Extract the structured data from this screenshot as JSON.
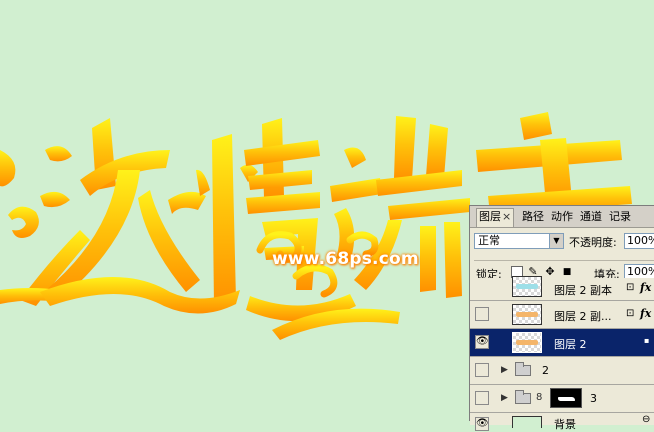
{
  "canvas": {
    "background": "#d1efd0",
    "title_text": "浓情端午",
    "gradient_top": "#fff21a",
    "gradient_bottom": "#ff9200",
    "watermark": "www.68ps.com"
  },
  "panel": {
    "tabs": [
      {
        "label": "图层",
        "active": true,
        "close": "×"
      },
      {
        "label": "路径"
      },
      {
        "label": "动作"
      },
      {
        "label": "通道"
      },
      {
        "label": "记录"
      }
    ],
    "blend_mode": "正常",
    "blend_arrow": "▼",
    "opacity_label": "不透明度:",
    "opacity_value": "100%",
    "lock_label": "锁定:",
    "fill_label": "填充:",
    "fill_value": "100%",
    "lock_icons": [
      "transparent-lock-icon",
      "brush-lock-icon",
      "move-lock-icon",
      "padlock-icon"
    ],
    "layers": [
      {
        "name": "图层 2 副本",
        "visible": false,
        "fx": "fx",
        "thumb_color": "#9edfe8"
      },
      {
        "name": "图层 2 副...",
        "visible": false,
        "fx": "fx",
        "thumb_color": "#f4b56a"
      },
      {
        "name": "图层 2",
        "visible": true,
        "selected": true,
        "thumb_color": "#f4b56a"
      },
      {
        "name": "2",
        "visible": false,
        "group": true
      },
      {
        "name": "3",
        "visible": false,
        "group": true,
        "masked": true
      },
      {
        "name": "背景",
        "visible": true,
        "thumb_color": "#d1efd0"
      }
    ],
    "eye_glyph": "👁",
    "expand_glyph": "▶",
    "chain_glyph": "8",
    "lock_glyph": "🔒",
    "colors": {
      "selected_row": "#0a246a",
      "panel_bg": "#ece9d8"
    }
  }
}
